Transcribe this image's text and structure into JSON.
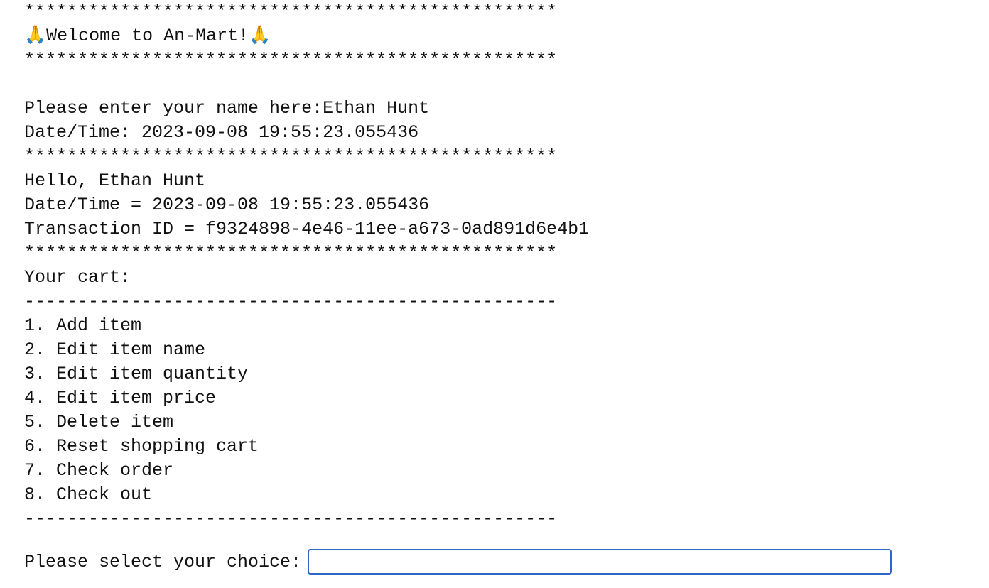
{
  "header": {
    "border_top": "**************************************************",
    "welcome": "🙏Welcome to An-Mart!🙏",
    "border_bottom": "**************************************************"
  },
  "login": {
    "name_prompt": "Please enter your name here:Ethan Hunt",
    "datetime": "Date/Time: 2023-09-08 19:55:23.055436",
    "border": "**************************************************"
  },
  "session": {
    "greeting": "Hello, Ethan Hunt",
    "datetime": "Date/Time = 2023-09-08 19:55:23.055436",
    "transaction": "Transaction ID = f9324898-4e46-11ee-a673-0ad891d6e4b1",
    "border": "**************************************************"
  },
  "cart": {
    "title": "Your cart:",
    "divider_top": "--------------------------------------------------",
    "menu": [
      "1. Add item",
      "2. Edit item name",
      "3. Edit item quantity",
      "4. Edit item price",
      "5. Delete item",
      "6. Reset shopping cart",
      "7. Check order",
      "8. Check out"
    ],
    "divider_bottom": "--------------------------------------------------"
  },
  "prompt": {
    "label": "Please select your choice:",
    "value": ""
  },
  "colors": {
    "text": "#111111",
    "input_border": "#2f65c4",
    "background": "#ffffff"
  }
}
